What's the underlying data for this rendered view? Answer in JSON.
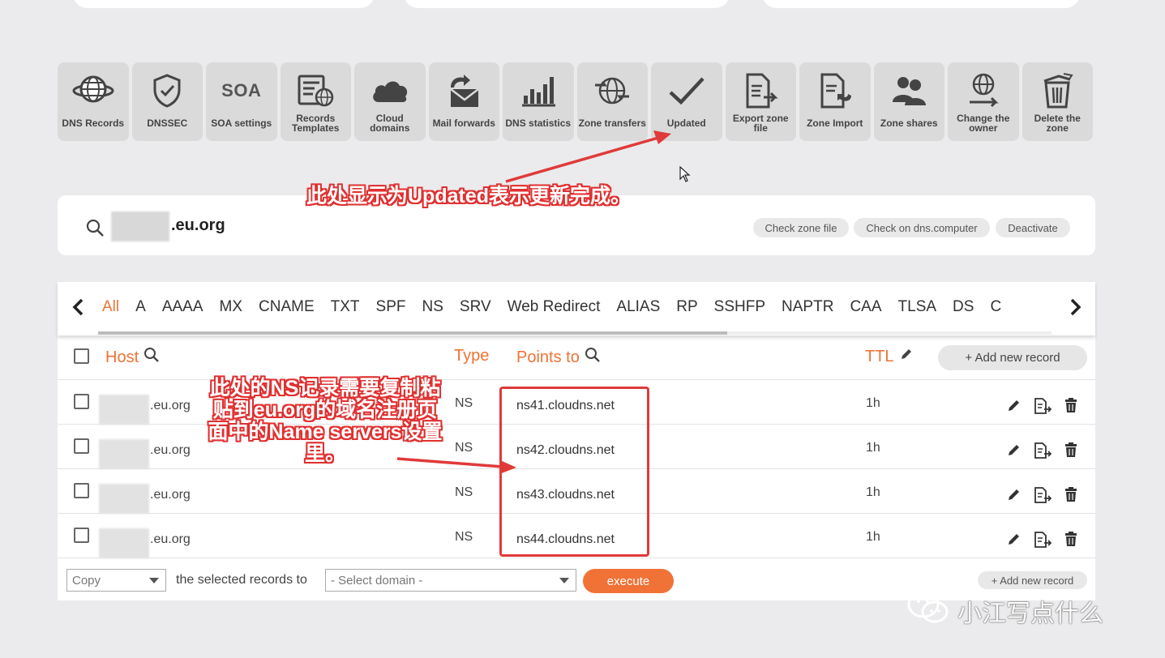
{
  "toolbar": {
    "items": [
      {
        "label": "DNS Records",
        "icon": "globe-icon"
      },
      {
        "label": "DNSSEC",
        "icon": "shield-check-icon"
      },
      {
        "label": "SOA settings",
        "icon": "soa-text-icon",
        "icon_text": "SOA"
      },
      {
        "label": "Records Templates",
        "icon": "template-globe-icon"
      },
      {
        "label": "Cloud domains",
        "icon": "cloud-icon"
      },
      {
        "label": "Mail forwards",
        "icon": "mail-forward-icon"
      },
      {
        "label": "DNS statistics",
        "icon": "bar-chart-icon"
      },
      {
        "label": "Zone transfers",
        "icon": "globe-arrows-icon"
      },
      {
        "label": "Updated",
        "icon": "checkmark-icon"
      },
      {
        "label": "Export zone file",
        "icon": "export-file-icon"
      },
      {
        "label": "Zone Import",
        "icon": "import-file-icon"
      },
      {
        "label": "Zone shares",
        "icon": "users-icon"
      },
      {
        "label": "Change the owner",
        "icon": "globe-owner-icon"
      },
      {
        "label": "Delete the zone",
        "icon": "trash-icon"
      }
    ]
  },
  "annotations": {
    "updated_note": "此处显示为Updated表示更新完成。",
    "ns_note": "此处的NS记录需要复制粘贴到eu.org的域名注册页面中的Name servers设置里。"
  },
  "zone": {
    "name": ".eu.org",
    "buttons": {
      "check_zone": "Check zone file",
      "check_dns": "Check on dns.computer",
      "deactivate": "Deactivate"
    }
  },
  "tabs": [
    "All",
    "A",
    "AAAA",
    "MX",
    "CNAME",
    "TXT",
    "SPF",
    "NS",
    "SRV",
    "Web Redirect",
    "ALIAS",
    "RP",
    "SSHFP",
    "NAPTR",
    "CAA",
    "TLSA",
    "DS",
    "C"
  ],
  "active_tab": "All",
  "table": {
    "headers": {
      "host": "Host",
      "type": "Type",
      "points_to": "Points to",
      "ttl": "TTL"
    },
    "add_record": "+ Add new record",
    "rows": [
      {
        "host": ".eu.org",
        "type": "NS",
        "points_to": "ns41.cloudns.net",
        "ttl": "1h"
      },
      {
        "host": ".eu.org",
        "type": "NS",
        "points_to": "ns42.cloudns.net",
        "ttl": "1h"
      },
      {
        "host": ".eu.org",
        "type": "NS",
        "points_to": "ns43.cloudns.net",
        "ttl": "1h"
      },
      {
        "host": ".eu.org",
        "type": "NS",
        "points_to": "ns44.cloudns.net",
        "ttl": "1h"
      }
    ]
  },
  "footer": {
    "action_select": "Copy",
    "middle_text": "the selected records to",
    "domain_select": "- Select domain -",
    "execute": "execute",
    "add_record": "+ Add new record"
  },
  "watermark": {
    "text": "小江写点什么",
    "icon": "wechat-icon"
  },
  "colors": {
    "accent": "#f07236",
    "annotation": "#e03a3a",
    "tool_bg": "#dadada",
    "page_bg": "#ebebed"
  }
}
